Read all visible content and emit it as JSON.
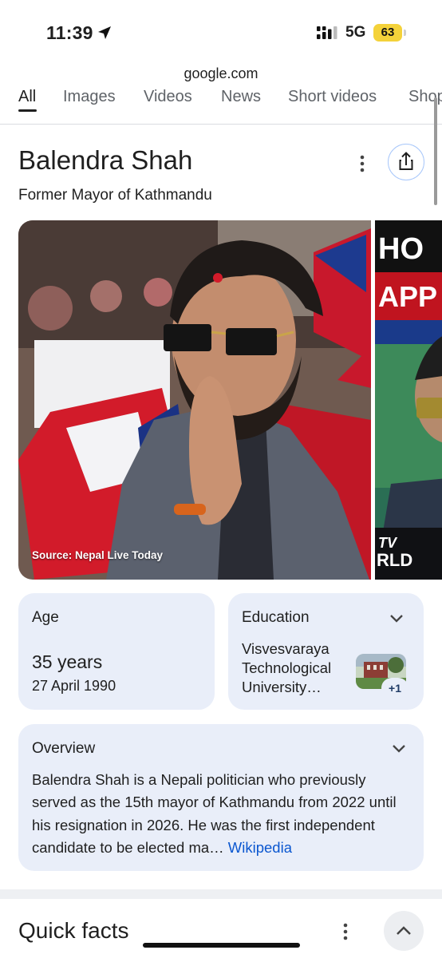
{
  "status_bar": {
    "time": "11:39",
    "network": "5G",
    "battery": "63",
    "battery_color": "#f4d23a",
    "icons": [
      "location-arrow-icon",
      "signal-icon",
      "battery-icon"
    ]
  },
  "browser": {
    "url": "google.com"
  },
  "tabs": [
    {
      "label": "All",
      "active": true
    },
    {
      "label": "Images"
    },
    {
      "label": "Videos"
    },
    {
      "label": "News"
    },
    {
      "label": "Short videos"
    },
    {
      "label": "Shop"
    }
  ],
  "entity": {
    "title": "Balendra Shah",
    "subtitle": "Former Mayor of Kathmandu",
    "icons": [
      "more-vert-icon",
      "share-icon"
    ]
  },
  "carousel": {
    "main_caption": "Source: Nepal Live Today",
    "second_overlay_top": "HO",
    "second_overlay_mid": "APP",
    "second_overlay_bottom1": "TV",
    "second_overlay_bottom2": "RLD"
  },
  "facts": {
    "age": {
      "label": "Age",
      "value": "35 years",
      "date": "27 April 1990"
    },
    "education": {
      "label": "Education",
      "value": "Visvesvaraya Technological University…",
      "extra_count": "+1",
      "icon": "chevron-down-icon"
    }
  },
  "overview": {
    "label": "Overview",
    "text": "Balendra Shah is a Nepali politician who previously served as the 15th mayor of Kathmandu from 2022 until his resignation in 2026. He was the first independent candidate to be elected ma…",
    "link": "Wikipedia",
    "accent": "#0b57d0"
  },
  "quick_facts": {
    "title": "Quick facts",
    "icons": [
      "more-vert-icon",
      "chevron-up-icon"
    ]
  }
}
